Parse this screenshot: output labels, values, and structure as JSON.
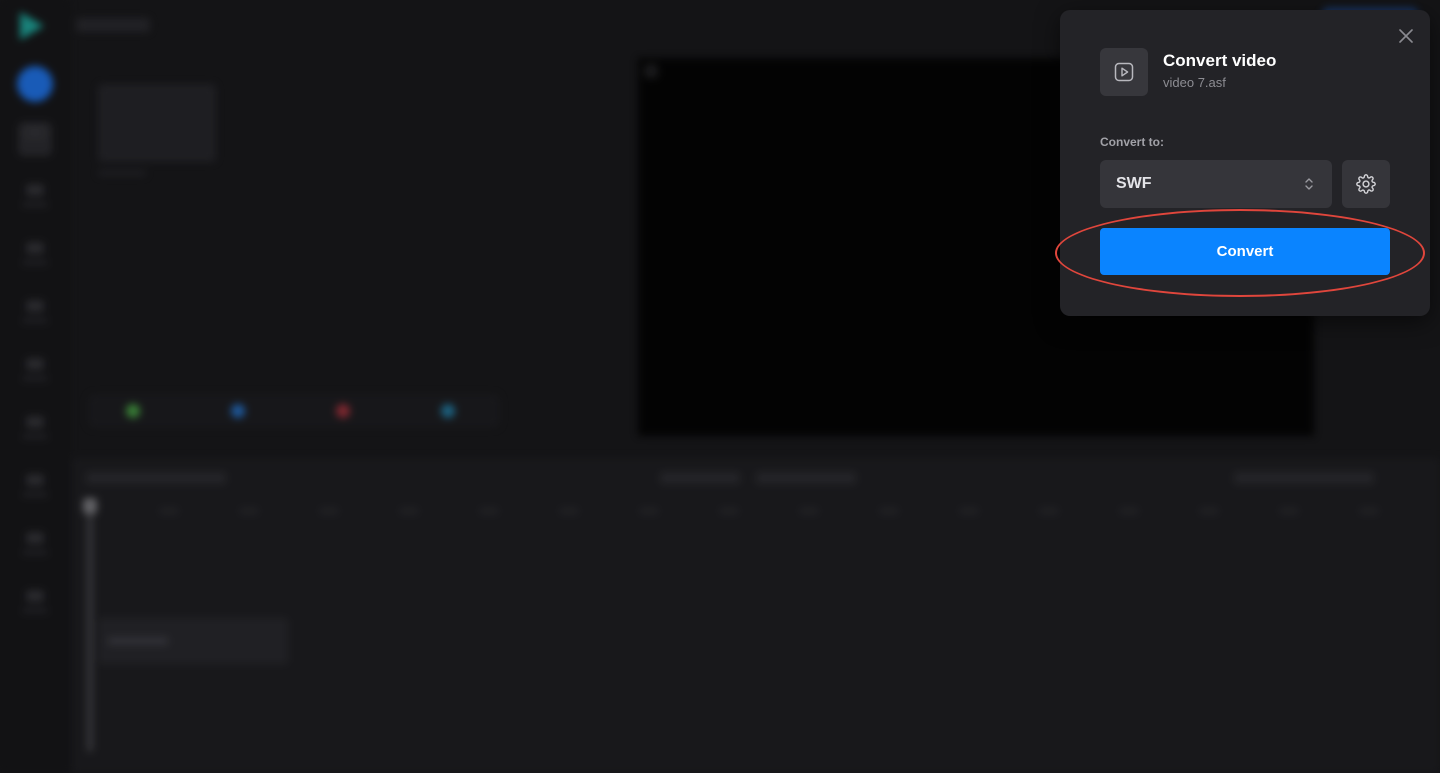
{
  "background": {
    "description_hidden": true
  },
  "dialog": {
    "title": "Convert video",
    "filename": "video 7.asf",
    "convert_to_label": "Convert to:",
    "format_selected": "SWF",
    "convert_button_label": "Convert"
  },
  "colors": {
    "accent": "#0a84ff",
    "dialog_bg": "#232327",
    "highlight": "#e0463c"
  },
  "icons": {
    "close": "close-icon",
    "file": "video-file-icon",
    "select_arrows": "chevron-up-down-icon",
    "settings": "gear-icon"
  }
}
